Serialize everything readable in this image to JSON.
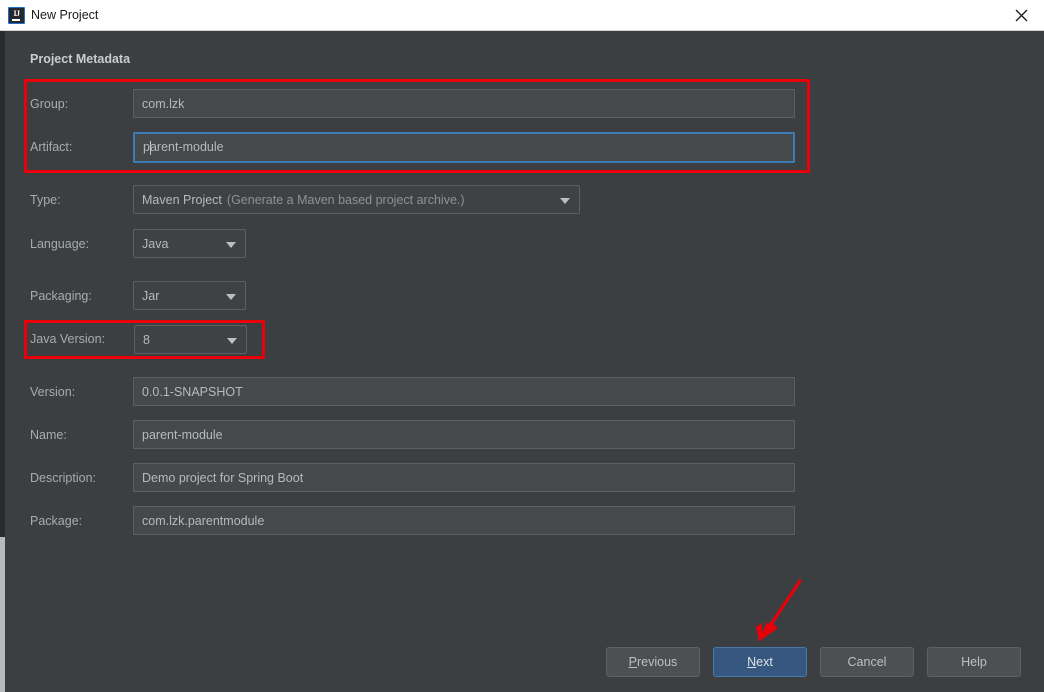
{
  "window": {
    "title": "New Project",
    "icon": "intellij-idea-icon",
    "icon_letters": "IJ",
    "close_label": "×"
  },
  "form": {
    "section_title": "Project Metadata",
    "fields": [
      {
        "label": "Group:",
        "value": "com.lzk",
        "type": "text",
        "focused": false
      },
      {
        "label": "Artifact:",
        "value": "parent-module",
        "type": "text",
        "focused": true
      },
      {
        "label": "Type:",
        "value": "Maven Project",
        "hint": "(Generate a Maven based project archive.)",
        "type": "combo"
      },
      {
        "label": "Language:",
        "value": "Java",
        "type": "combo"
      },
      {
        "label": "Packaging:",
        "value": "Jar",
        "type": "combo"
      },
      {
        "label": "Java Version:",
        "value": "8",
        "type": "combo"
      },
      {
        "label": "Version:",
        "value": "0.0.1-SNAPSHOT",
        "type": "text",
        "focused": false
      },
      {
        "label": "Name:",
        "value": "parent-module",
        "type": "text",
        "focused": false
      },
      {
        "label": "Description:",
        "value": "Demo project for Spring Boot",
        "type": "text",
        "focused": false
      },
      {
        "label": "Package:",
        "value": "com.lzk.parentmodule",
        "type": "text",
        "focused": false
      }
    ]
  },
  "buttons": {
    "previous": {
      "label": "Previous",
      "mnemonic": "P",
      "rest": "revious"
    },
    "next": {
      "label": "Next",
      "mnemonic": "N",
      "rest": "ext"
    },
    "cancel": {
      "label": "Cancel"
    },
    "help": {
      "label": "Help"
    }
  },
  "annotations": {
    "color": "#e8000b",
    "boxes": [
      {
        "name": "group-artifact-highlight"
      },
      {
        "name": "java-version-highlight"
      }
    ],
    "arrow": {
      "name": "next-button-arrow",
      "points_to": "Next"
    }
  }
}
